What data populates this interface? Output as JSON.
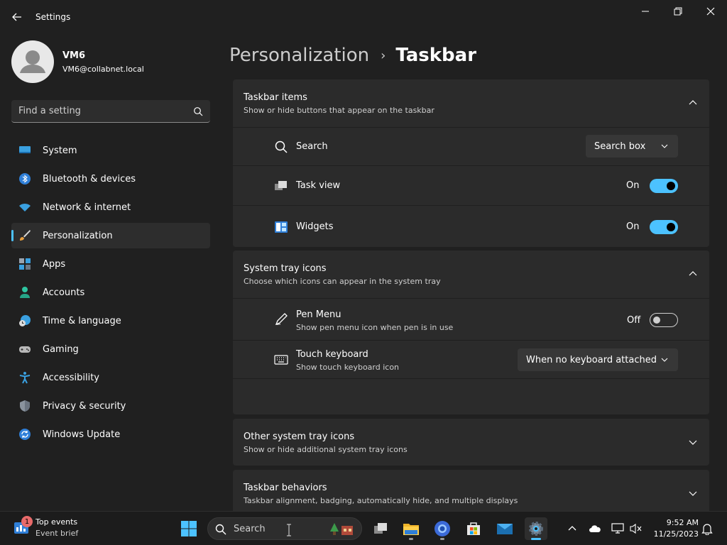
{
  "window": {
    "title": "Settings"
  },
  "profile": {
    "name": "VM6",
    "email": "VM6@collabnet.local"
  },
  "search": {
    "placeholder": "Find a setting"
  },
  "nav": {
    "items": [
      {
        "label": "System",
        "icon": "monitor-icon"
      },
      {
        "label": "Bluetooth & devices",
        "icon": "bluetooth-icon"
      },
      {
        "label": "Network & internet",
        "icon": "wifi-icon"
      },
      {
        "label": "Personalization",
        "icon": "brush-icon",
        "active": true
      },
      {
        "label": "Apps",
        "icon": "apps-icon"
      },
      {
        "label": "Accounts",
        "icon": "person-icon"
      },
      {
        "label": "Time & language",
        "icon": "globe-clock-icon"
      },
      {
        "label": "Gaming",
        "icon": "gamepad-icon"
      },
      {
        "label": "Accessibility",
        "icon": "accessibility-icon"
      },
      {
        "label": "Privacy & security",
        "icon": "shield-icon"
      },
      {
        "label": "Windows Update",
        "icon": "update-icon"
      }
    ]
  },
  "breadcrumb": {
    "parent": "Personalization",
    "separator": "›",
    "current": "Taskbar"
  },
  "sections": {
    "taskbar_items": {
      "title": "Taskbar items",
      "subtitle": "Show or hide buttons that appear on the taskbar",
      "rows": {
        "search": {
          "label": "Search",
          "value": "Search box"
        },
        "task_view": {
          "label": "Task view",
          "state": "On"
        },
        "widgets": {
          "label": "Widgets",
          "state": "On"
        }
      }
    },
    "system_tray": {
      "title": "System tray icons",
      "subtitle": "Choose which icons can appear in the system tray",
      "rows": {
        "pen_menu": {
          "label": "Pen Menu",
          "subtitle": "Show pen menu icon when pen is in use",
          "state": "Off"
        },
        "touch_keyboard": {
          "label": "Touch keyboard",
          "subtitle": "Show touch keyboard icon",
          "value": "When no keyboard attached"
        }
      }
    },
    "other_tray": {
      "title": "Other system tray icons",
      "subtitle": "Show or hide additional system tray icons"
    },
    "behaviors": {
      "title": "Taskbar behaviors",
      "subtitle": "Taskbar alignment, badging, automatically hide, and multiple displays"
    }
  },
  "taskbar": {
    "news": {
      "badge": "1",
      "title": "Top events",
      "subtitle": "Event brief"
    },
    "search_label": "Search",
    "clock": {
      "time": "9:52 AM",
      "date": "11/25/2023"
    }
  },
  "colors": {
    "accent": "#4cc2ff",
    "background": "#202020",
    "card": "#2b2b2b"
  }
}
